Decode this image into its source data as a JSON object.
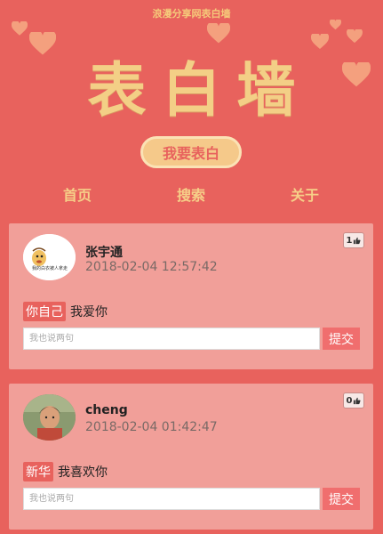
{
  "site": {
    "subtitle": "浪漫分享网表白墙",
    "title": "表白墙",
    "confess_button": "我要表白"
  },
  "nav": {
    "items": [
      {
        "label": "首页"
      },
      {
        "label": "搜索"
      },
      {
        "label": "关于"
      }
    ]
  },
  "posts": [
    {
      "username": "张宇通",
      "timestamp": "2018-02-04 12:57:42",
      "likes": "1",
      "target": "你自己",
      "message": "我爱你",
      "avatar_text": "我的白衣被人拿走",
      "comment_placeholder": "我也说两句",
      "submit_label": "提交"
    },
    {
      "username": "cheng",
      "timestamp": "2018-02-04 01:42:47",
      "likes": "0",
      "target": "新华",
      "message": "我喜欢你",
      "comment_placeholder": "我也说两句",
      "submit_label": "提交"
    }
  ],
  "colors": {
    "background": "#e8625d",
    "title_gold": "#f3cf86",
    "card": "#f19f99",
    "submit": "#f06e6e"
  },
  "icons": {
    "decor": "heart-icon",
    "like": "thumbs-up-icon"
  }
}
